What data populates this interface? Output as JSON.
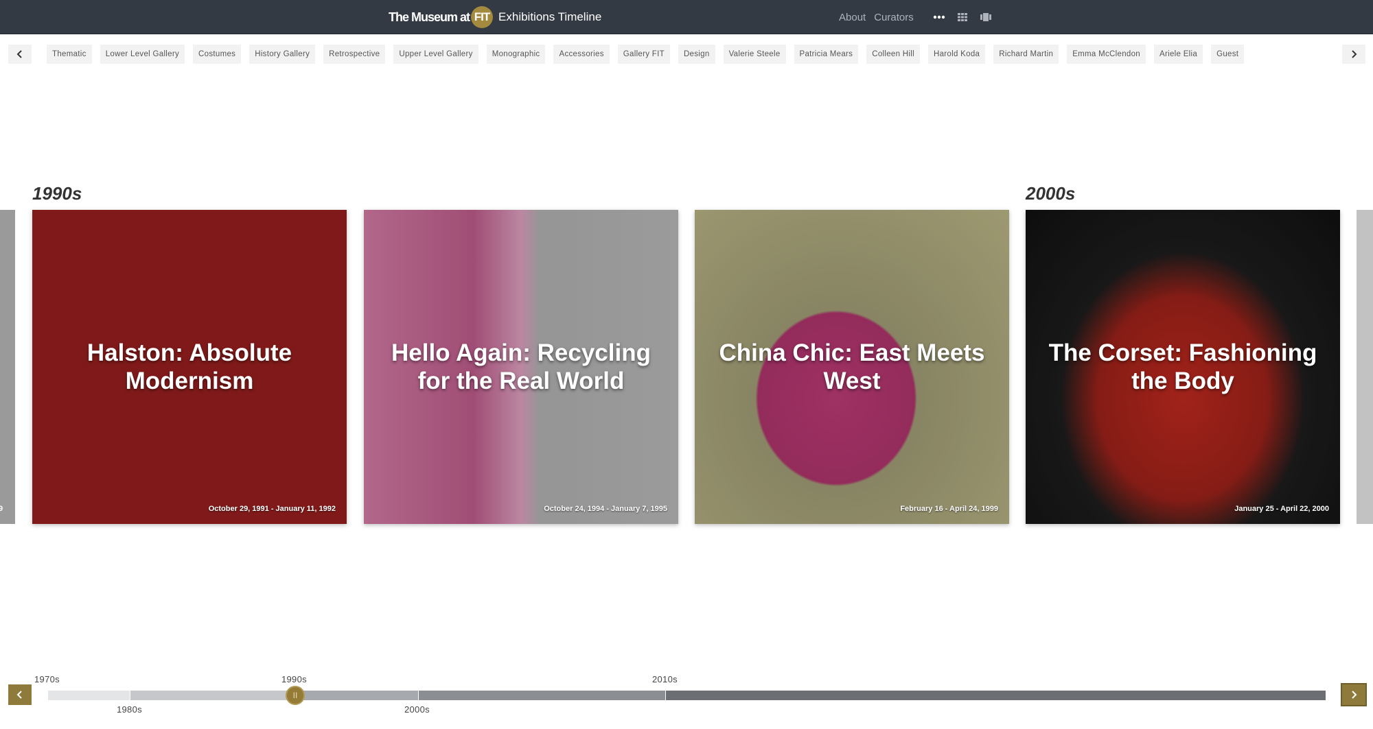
{
  "header": {
    "brand": "The Museum at",
    "brand_badge": "FIT",
    "subtitle": "Exhibitions Timeline",
    "nav": [
      "About",
      "Curators"
    ],
    "icons": [
      "more-icon",
      "grid-view-icon",
      "carousel-view-icon"
    ]
  },
  "tags": [
    "Thematic",
    "Lower Level Gallery",
    "Costumes",
    "History Gallery",
    "Retrospective",
    "Upper Level Gallery",
    "Monographic",
    "Accessories",
    "Gallery FIT",
    "Design",
    "Valerie Steele",
    "Patricia Mears",
    "Colleen Hill",
    "Harold Koda",
    "Richard Martin",
    "Emma McClendon",
    "Ariele Elia",
    "Guest"
  ],
  "decades_shown": {
    "first": "1990s",
    "second": "2000s"
  },
  "edge_card_date": "9",
  "cards": [
    {
      "title": "Halston: Absolute Modernism",
      "date": "October 29, 1991 - January 11, 1992"
    },
    {
      "title": "Hello Again: Recycling for the Real World",
      "date": "October 24, 1994 - January 7, 1995"
    },
    {
      "title": "China Chic: East Meets West",
      "date": "February 16 - April 24, 1999"
    },
    {
      "title": "The Corset: Fashioning the Body",
      "date": "January 25 - April 22, 2000"
    }
  ],
  "timeline": {
    "labels_top": [
      "1970s",
      "1990s",
      "2010s"
    ],
    "labels_bottom": [
      "1980s",
      "2000s"
    ],
    "current": "1990s",
    "handle_glyph": "II",
    "colors": [
      "#e4e5e6",
      "#c5c7ca",
      "#a6a9ad",
      "#8b8e92",
      "#6b6e73"
    ]
  },
  "colors": {
    "header_bg": "#343a44",
    "accent_gold": "#a38a3f"
  }
}
